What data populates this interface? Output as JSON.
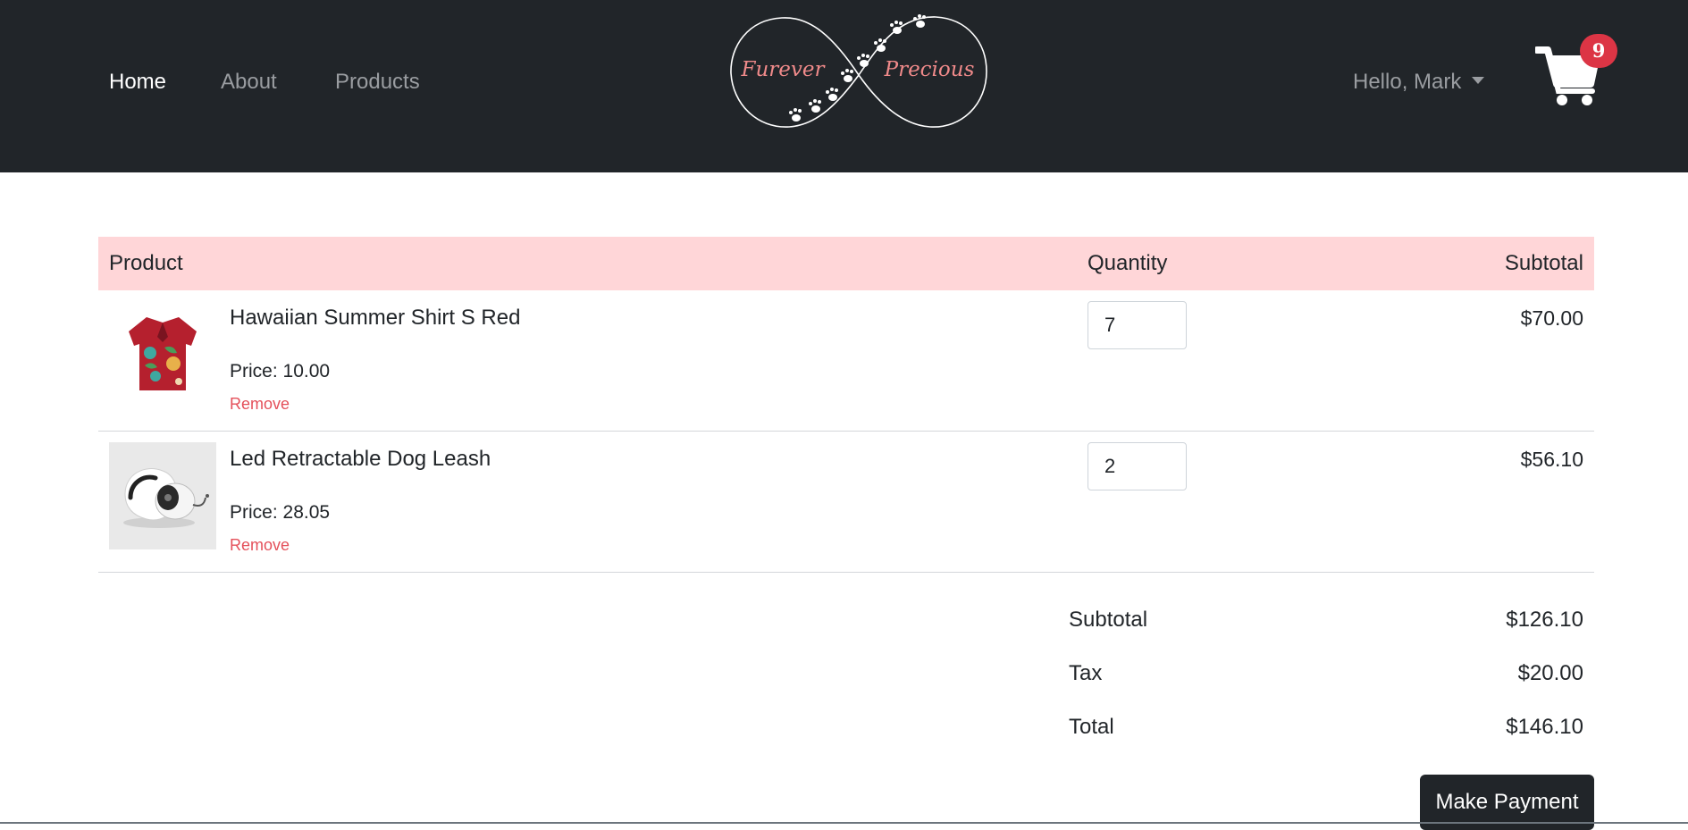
{
  "nav": {
    "links": [
      {
        "label": "Home",
        "active": true
      },
      {
        "label": "About",
        "active": false
      },
      {
        "label": "Products",
        "active": false
      }
    ],
    "user_greeting": "Hello, Mark",
    "cart_count": "9"
  },
  "logo": {
    "left_text": "Furever",
    "right_text": "Precious"
  },
  "table": {
    "headers": {
      "product": "Product",
      "quantity": "Quantity",
      "subtotal": "Subtotal"
    },
    "items": [
      {
        "name": "Hawaiian Summer Shirt S Red",
        "price": "Price: 10.00",
        "remove": "Remove",
        "quantity": "7",
        "subtotal": "$70.00",
        "icon": "hawaiian-shirt-image"
      },
      {
        "name": "Led Retractable Dog Leash",
        "price": "Price: 28.05",
        "remove": "Remove",
        "quantity": "2",
        "subtotal": "$56.10",
        "icon": "dog-leash-image"
      }
    ]
  },
  "summary": {
    "subtotal_label": "Subtotal",
    "subtotal_value": "$126.10",
    "tax_label": "Tax",
    "tax_value": "$20.00",
    "total_label": "Total",
    "total_value": "$146.10"
  },
  "actions": {
    "pay_label": "Make Payment"
  },
  "colors": {
    "navbar": "#212529",
    "header_row": "#ffd6d8",
    "remove_link": "#e4505a",
    "badge": "#dc3545",
    "logo_text": "#f08a8a"
  }
}
